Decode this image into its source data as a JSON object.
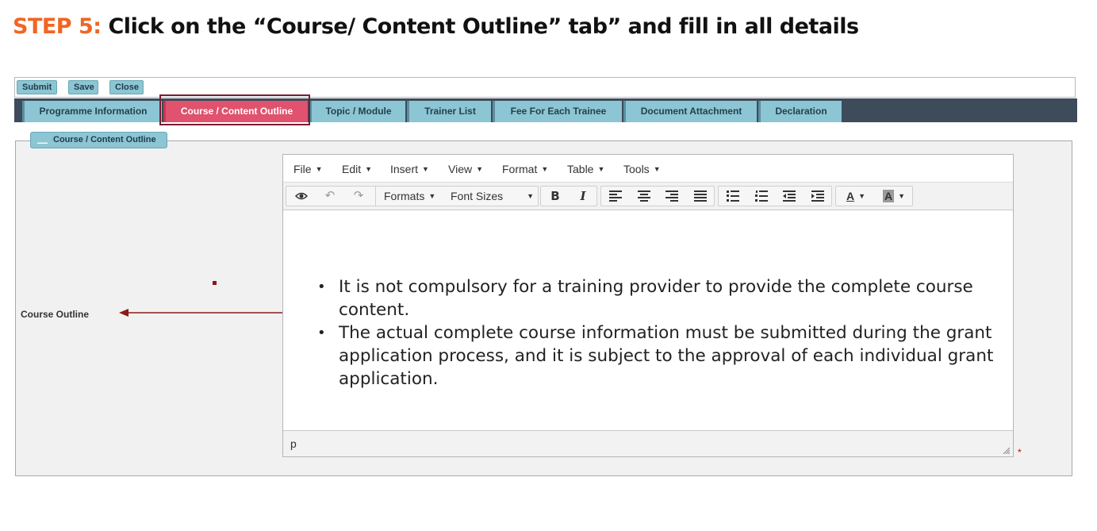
{
  "heading": {
    "step": "STEP 5:",
    "text": " Click on the “Course/ Content Outline” tab” and fill in all details"
  },
  "actions": {
    "submit": "Submit",
    "save": "Save",
    "close": "Close"
  },
  "tabs": [
    {
      "label": "Programme Information"
    },
    {
      "label": "Course / Content Outline",
      "active": true
    },
    {
      "label": "Topic / Module"
    },
    {
      "label": "Trainer List"
    },
    {
      "label": "Fee For Each Trainee"
    },
    {
      "label": "Document Attachment"
    },
    {
      "label": "Declaration"
    }
  ],
  "section": {
    "legend": "Course / Content Outline",
    "field_label": "Course Outline",
    "required_mark": "*"
  },
  "editor": {
    "menus": [
      "File",
      "Edit",
      "Insert",
      "View",
      "Format",
      "Table",
      "Tools"
    ],
    "formats_label": "Formats",
    "font_sizes_label": "Font Sizes",
    "icons": [
      "eye-icon",
      "undo-icon",
      "redo-icon",
      "bold-icon",
      "italic-icon",
      "align-left-icon",
      "align-center-icon",
      "align-right-icon",
      "align-justify-icon",
      "bullet-list-icon",
      "numbered-list-icon",
      "outdent-icon",
      "indent-icon",
      "text-color-icon",
      "background-color-icon"
    ],
    "content": [
      "It is not compulsory for a training provider to provide the complete course content.",
      "The actual complete course information must be submitted during the grant application process, and it is subject to the approval of each individual grant application."
    ],
    "status_path": "p"
  },
  "colors": {
    "step_accent": "#f26522",
    "tab": "#8cc5d3",
    "active_tab": "#e0526e",
    "tab_bar": "#3d4b5a",
    "highlight": "#7a1d2e",
    "arrow": "#8b1a1a"
  }
}
